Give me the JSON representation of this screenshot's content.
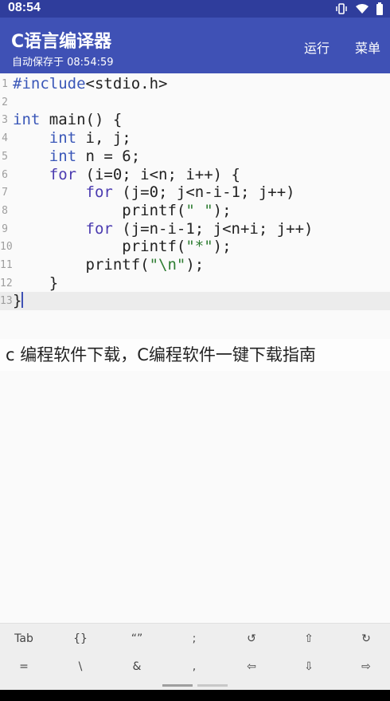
{
  "status_bar": {
    "time": "08:54"
  },
  "app_bar": {
    "title": "C语言编译器",
    "subtitle": "自动保存于 08:54:59",
    "actions": [
      {
        "label": "运行"
      },
      {
        "label": "菜单"
      }
    ]
  },
  "editor": {
    "lines": [
      {
        "num": "1",
        "code": "#include<stdio.h>"
      },
      {
        "num": "2",
        "code": ""
      },
      {
        "num": "3",
        "code": "int main() {"
      },
      {
        "num": "4",
        "code": "    int i, j;"
      },
      {
        "num": "5",
        "code": "    int n = 6;"
      },
      {
        "num": "6",
        "code": "    for (i=0; i<n; i++) {"
      },
      {
        "num": "7",
        "code": "        for (j=0; j<n-i-1; j++)"
      },
      {
        "num": "8",
        "code": "            printf(\" \");"
      },
      {
        "num": "9",
        "code": "        for (j=n-i-1; j<n+i; j++)"
      },
      {
        "num": "10",
        "code": "            printf(\"*\");"
      },
      {
        "num": "11",
        "code": "        printf(\"\\n\");"
      },
      {
        "num": "12",
        "code": "    }"
      },
      {
        "num": "13",
        "code": "}"
      }
    ]
  },
  "caption": "c 编程软件下载，C编程软件一键下载指南",
  "keyboard": {
    "row1": [
      "Tab",
      "{}",
      "“”",
      ";",
      "↺",
      "⇧",
      "↻"
    ],
    "row2": [
      "=",
      "\\",
      "&",
      ",",
      "⇦",
      "⇩",
      "⇨"
    ]
  }
}
